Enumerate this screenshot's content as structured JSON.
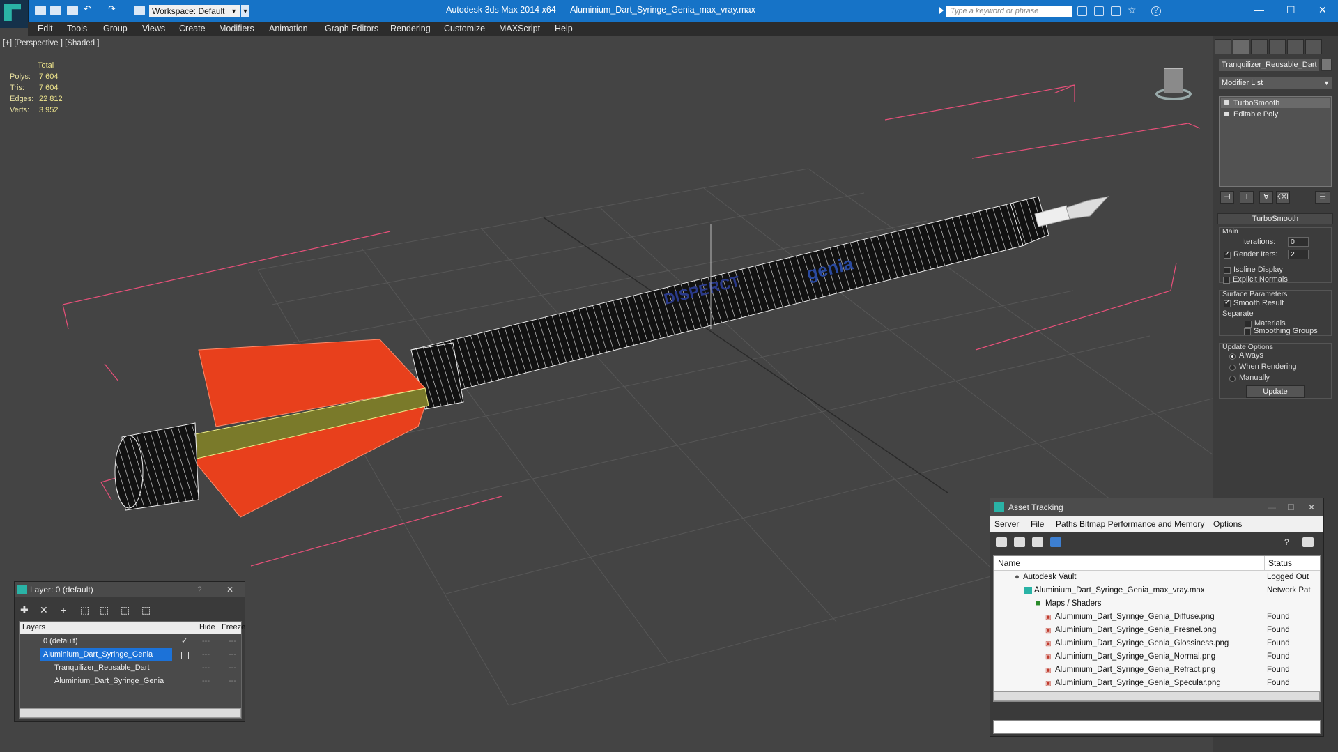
{
  "app": {
    "title": "Autodesk 3ds Max  2014 x64",
    "file": "Aluminium_Dart_Syringe_Genia_max_vray.max",
    "workspace": "Workspace: Default",
    "search_placeholder": "Type a keyword or phrase"
  },
  "menu": [
    "Edit",
    "Tools",
    "Group",
    "Views",
    "Create",
    "Modifiers",
    "Animation",
    "Graph Editors",
    "Rendering",
    "Customize",
    "MAXScript",
    "Help"
  ],
  "viewport": {
    "label": "[+] [Perspective ] [Shaded ]",
    "stats": {
      "header": "Total",
      "rows": [
        {
          "k": "Polys:",
          "v": "7 604"
        },
        {
          "k": "Tris:",
          "v": "7 604"
        },
        {
          "k": "Edges:",
          "v": "22 812"
        },
        {
          "k": "Verts:",
          "v": "3 952"
        }
      ]
    },
    "text_on_model": [
      "DISPERCT",
      "genia"
    ],
    "colors": {
      "fin": "#e8401c",
      "wire": "#ffffff",
      "bbox": "#e8507a",
      "grid": "#5a5a5a"
    }
  },
  "command_panel": {
    "object_name": "Tranquilizer_Reusable_Dart",
    "modifier_list": "Modifier List",
    "stack": [
      "TurboSmooth",
      "Editable Poly"
    ],
    "turbosmooth": {
      "title": "TurboSmooth",
      "main": "Main",
      "iterations_label": "Iterations:",
      "iterations": "0",
      "render_iters_label": "Render Iters:",
      "render_iters": "2",
      "isoline": "Isoline Display",
      "explicit": "Explicit Normals",
      "surface": "Surface Parameters",
      "smooth_result": "Smooth Result",
      "separate": "Separate",
      "materials": "Materials",
      "smoothing_groups": "Smoothing Groups",
      "update_options": "Update Options",
      "always": "Always",
      "when_rendering": "When Rendering",
      "manually": "Manually",
      "update_btn": "Update"
    }
  },
  "layer_window": {
    "title": "Layer: 0 (default)",
    "help": "?",
    "close": "✕",
    "columns": [
      "Layers",
      "Hide",
      "Freeze"
    ],
    "rows": [
      {
        "name": "0 (default)",
        "indent": 0
      },
      {
        "name": "Aluminium_Dart_Syringe_Genia",
        "indent": 0,
        "selected": true
      },
      {
        "name": "Tranquilizer_Reusable_Dart",
        "indent": 1
      },
      {
        "name": "Aluminium_Dart_Syringe_Genia",
        "indent": 1
      }
    ]
  },
  "asset_window": {
    "title": "Asset Tracking",
    "menu": [
      "Server",
      "File",
      "Paths",
      "Bitmap Performance and Memory",
      "Options"
    ],
    "columns": [
      "Name",
      "Status"
    ],
    "rows": [
      {
        "name": "Autodesk Vault",
        "status": "Logged Out",
        "indent": 0
      },
      {
        "name": "Aluminium_Dart_Syringe_Genia_max_vray.max",
        "status": "Network Pat",
        "indent": 1
      },
      {
        "name": "Maps / Shaders",
        "status": "",
        "indent": 2
      },
      {
        "name": "Aluminium_Dart_Syringe_Genia_Diffuse.png",
        "status": "Found",
        "indent": 3
      },
      {
        "name": "Aluminium_Dart_Syringe_Genia_Fresnel.png",
        "status": "Found",
        "indent": 3
      },
      {
        "name": "Aluminium_Dart_Syringe_Genia_Glossiness.png",
        "status": "Found",
        "indent": 3
      },
      {
        "name": "Aluminium_Dart_Syringe_Genia_Normal.png",
        "status": "Found",
        "indent": 3
      },
      {
        "name": "Aluminium_Dart_Syringe_Genia_Refract.png",
        "status": "Found",
        "indent": 3
      },
      {
        "name": "Aluminium_Dart_Syringe_Genia_Specular.png",
        "status": "Found",
        "indent": 3
      }
    ]
  }
}
